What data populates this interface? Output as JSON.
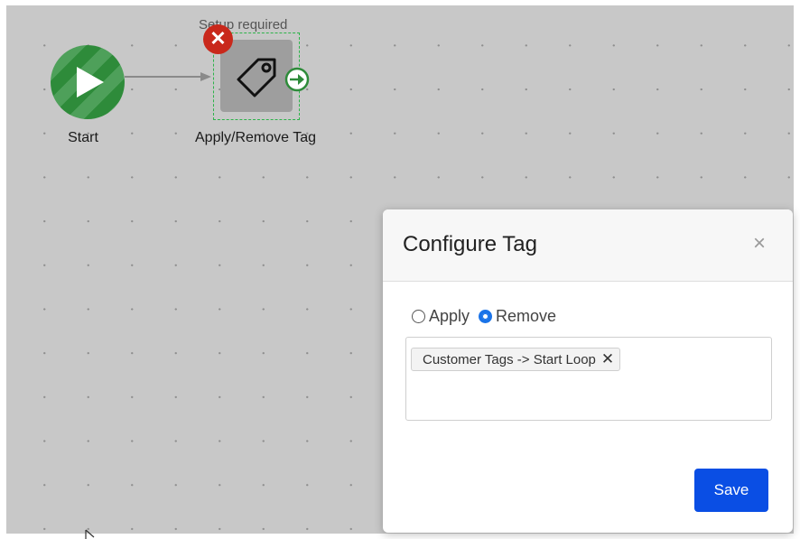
{
  "canvas": {
    "start_node": {
      "label": "Start",
      "icon": "play-icon",
      "color": "#2e8b3a"
    },
    "tag_node": {
      "status_text": "Setup required",
      "label": "Apply/Remove Tag",
      "icon": "tag-icon",
      "error_icon": "close-icon",
      "output_icon": "arrow-right-circle-icon"
    }
  },
  "modal": {
    "title": "Configure Tag",
    "close_glyph": "×",
    "options": [
      {
        "label": "Apply",
        "selected": false
      },
      {
        "label": "Remove",
        "selected": true
      }
    ],
    "tags": [
      {
        "label": "Customer Tags -> Start Loop",
        "remove_glyph": "✕"
      }
    ],
    "save_label": "Save"
  },
  "colors": {
    "accent": "#0a4ee4",
    "success": "#2e8b3a",
    "error": "#c9281b",
    "selection": "#2db34a"
  }
}
